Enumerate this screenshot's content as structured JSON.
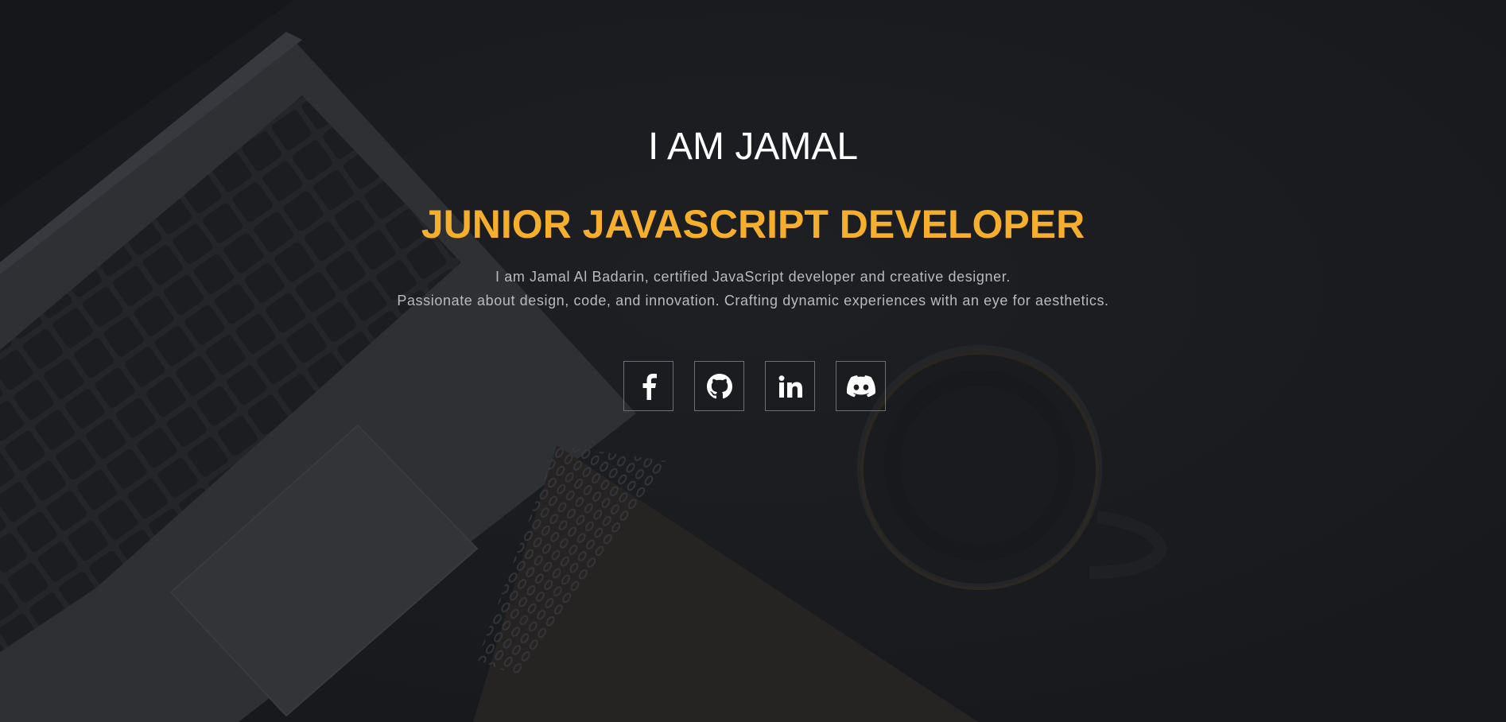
{
  "hero": {
    "intro": "I AM JAMAL",
    "role": "JUNIOR JAVASCRIPT DEVELOPER",
    "description_lines": [
      "I am Jamal Al Badarin, certified JavaScript developer and creative designer.",
      "Passionate about design, code, and innovation. Crafting dynamic experiences with an eye for aesthetics."
    ]
  },
  "socials": [
    {
      "icon": "facebook-icon"
    },
    {
      "icon": "github-icon"
    },
    {
      "icon": "linkedin-icon"
    },
    {
      "icon": "discord-icon"
    }
  ],
  "colors": {
    "accent": "#f6ae2d",
    "background": "#1d1e22",
    "text": "#ffffff",
    "muted_text": "#b9babe"
  }
}
